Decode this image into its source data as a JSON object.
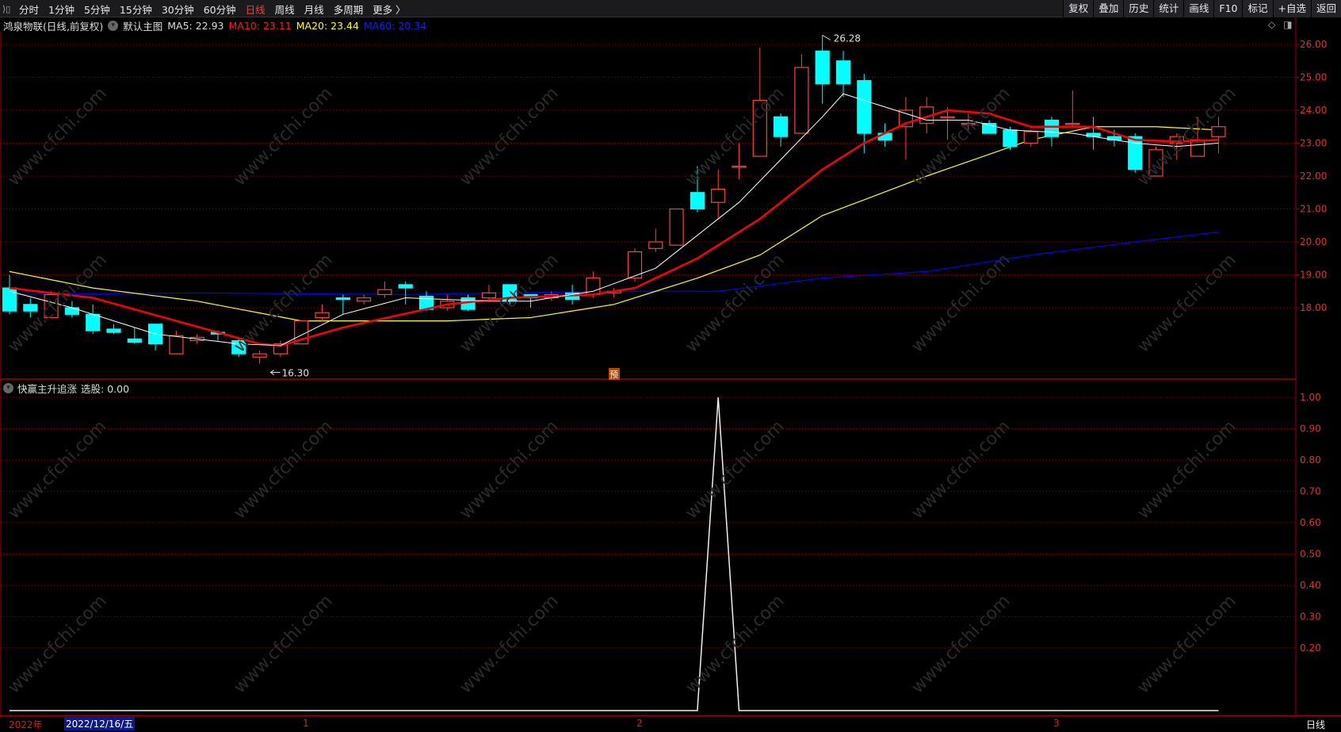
{
  "toolbar": {
    "periods": [
      "分时",
      "1分钟",
      "5分钟",
      "15分钟",
      "30分钟",
      "60分钟",
      "日线",
      "周线",
      "月线",
      "多周期",
      "更多 〉"
    ],
    "active_period": "日线",
    "right_buttons": [
      "复权",
      "叠加",
      "历史",
      "统计",
      "画线",
      "F10",
      "标记",
      "+自选",
      "返回"
    ]
  },
  "info": {
    "title": "鸿泉物联(日线,前复权)",
    "template": "默认主图",
    "ma5": "MA5: 22.93",
    "ma10": "MA10: 23.11",
    "ma20": "MA20: 23.44",
    "ma60": "MA60: 20.34"
  },
  "colors": {
    "up": "#ff4040",
    "down": "#00ffff",
    "ma5": "#ffffff",
    "ma10": "#ff0000",
    "ma20": "#ffff00",
    "ma60": "#0000ff",
    "grid": "#8b0000"
  },
  "annotations": {
    "high": "26.28",
    "low": "16.30",
    "badge": "预"
  },
  "sub": {
    "title": "快赢主升追涨",
    "value": "选股: 0.00"
  },
  "dates": {
    "year": "2022年",
    "cursor": "2022/12/16/五",
    "months": [
      "1",
      "2",
      "3"
    ],
    "period": "日线"
  },
  "watermark": "www.cfchi.com",
  "chart_data": {
    "type": "candlestick",
    "price_ticks": [
      "26.00",
      "25.00",
      "24.00",
      "23.00",
      "22.00",
      "21.00",
      "20.00",
      "19.00",
      "18.00"
    ],
    "ohlc": [
      [
        18.6,
        19.0,
        17.8,
        17.9
      ],
      [
        18.1,
        18.3,
        17.7,
        17.9
      ],
      [
        17.7,
        18.5,
        17.7,
        18.4
      ],
      [
        18.0,
        18.2,
        17.7,
        17.8
      ],
      [
        17.8,
        18.1,
        17.2,
        17.3
      ],
      [
        17.35,
        17.5,
        17.2,
        17.25
      ],
      [
        17.05,
        17.4,
        16.9,
        16.95
      ],
      [
        17.5,
        17.5,
        16.7,
        16.9
      ],
      [
        16.6,
        17.3,
        16.6,
        17.15
      ],
      [
        17.0,
        17.2,
        16.9,
        17.1
      ],
      [
        17.25,
        17.3,
        17.0,
        17.2
      ],
      [
        17.0,
        17.1,
        16.5,
        16.6
      ],
      [
        16.5,
        16.7,
        16.3,
        16.6
      ],
      [
        16.6,
        17.0,
        16.5,
        16.9
      ],
      [
        16.9,
        17.6,
        16.9,
        17.6
      ],
      [
        17.7,
        18.1,
        17.6,
        17.85
      ],
      [
        18.3,
        18.4,
        17.8,
        18.25
      ],
      [
        18.2,
        18.4,
        18.1,
        18.3
      ],
      [
        18.4,
        18.8,
        18.3,
        18.55
      ],
      [
        18.7,
        18.8,
        18.1,
        18.6
      ],
      [
        18.35,
        18.5,
        17.9,
        17.95
      ],
      [
        18.0,
        18.4,
        17.9,
        18.2
      ],
      [
        18.3,
        18.4,
        17.9,
        17.95
      ],
      [
        18.3,
        18.7,
        18.2,
        18.45
      ],
      [
        18.7,
        18.7,
        18.1,
        18.2
      ],
      [
        18.4,
        18.4,
        18.0,
        18.3
      ],
      [
        18.3,
        18.5,
        18.2,
        18.4
      ],
      [
        18.45,
        18.7,
        18.1,
        18.25
      ],
      [
        18.4,
        19.1,
        18.3,
        18.9
      ],
      [
        18.45,
        18.6,
        18.3,
        18.5
      ],
      [
        18.9,
        19.8,
        18.8,
        19.7
      ],
      [
        19.8,
        20.4,
        19.7,
        20.0
      ],
      [
        19.9,
        21.0,
        19.9,
        21.0
      ],
      [
        21.5,
        22.3,
        20.9,
        21.0
      ],
      [
        21.2,
        22.2,
        20.7,
        21.6
      ],
      [
        22.3,
        23.0,
        21.9,
        22.3
      ],
      [
        22.6,
        25.9,
        22.6,
        24.3
      ],
      [
        23.8,
        23.9,
        22.9,
        23.2
      ],
      [
        23.3,
        25.7,
        23.3,
        25.3
      ],
      [
        25.8,
        26.28,
        24.2,
        24.8
      ],
      [
        25.5,
        25.8,
        24.4,
        24.8
      ],
      [
        24.9,
        25.1,
        22.7,
        23.3
      ],
      [
        23.3,
        23.6,
        22.9,
        23.1
      ],
      [
        23.5,
        24.4,
        22.5,
        24.0
      ],
      [
        23.6,
        24.4,
        23.3,
        24.1
      ],
      [
        23.8,
        24.1,
        23.1,
        23.8
      ],
      [
        23.6,
        23.9,
        23.4,
        23.6
      ],
      [
        23.6,
        23.7,
        23.3,
        23.3
      ],
      [
        23.4,
        23.5,
        22.8,
        22.9
      ],
      [
        23.0,
        23.4,
        22.9,
        23.35
      ],
      [
        23.7,
        23.8,
        22.9,
        23.2
      ],
      [
        23.6,
        24.6,
        23.5,
        23.6
      ],
      [
        23.3,
        23.8,
        22.8,
        23.2
      ],
      [
        23.2,
        23.4,
        22.9,
        23.1
      ],
      [
        23.2,
        23.3,
        22.1,
        22.2
      ],
      [
        22.0,
        22.9,
        22.0,
        22.8
      ],
      [
        23.0,
        23.3,
        22.5,
        23.2
      ],
      [
        22.6,
        23.8,
        22.6,
        23.1
      ],
      [
        23.2,
        23.8,
        22.7,
        23.5
      ]
    ],
    "ma_knots": {
      "ma5": [
        [
          1,
          18.5
        ],
        [
          4,
          18.0
        ],
        [
          8,
          17.2
        ],
        [
          12,
          16.9
        ],
        [
          14,
          16.85
        ],
        [
          17,
          17.8
        ],
        [
          20,
          18.3
        ],
        [
          24,
          18.2
        ],
        [
          26,
          18.2
        ],
        [
          29,
          18.5
        ],
        [
          32,
          19.2
        ],
        [
          34,
          20.2
        ],
        [
          36,
          21.2
        ],
        [
          38,
          22.5
        ],
        [
          40,
          23.8
        ],
        [
          41,
          24.5
        ],
        [
          43,
          24.1
        ],
        [
          45,
          23.7
        ],
        [
          47,
          23.7
        ],
        [
          49,
          23.4
        ],
        [
          52,
          23.3
        ],
        [
          55,
          23.0
        ],
        [
          57,
          22.9
        ],
        [
          59,
          23.0
        ]
      ],
      "ma10": [
        [
          1,
          18.6
        ],
        [
          5,
          18.3
        ],
        [
          9,
          17.6
        ],
        [
          13,
          16.9
        ],
        [
          14,
          16.85
        ],
        [
          17,
          17.4
        ],
        [
          22,
          18.1
        ],
        [
          25,
          18.3
        ],
        [
          29,
          18.4
        ],
        [
          31,
          18.6
        ],
        [
          34,
          19.5
        ],
        [
          37,
          20.7
        ],
        [
          40,
          22.2
        ],
        [
          42,
          23.0
        ],
        [
          44,
          23.6
        ],
        [
          46,
          24.0
        ],
        [
          48,
          23.9
        ],
        [
          50,
          23.5
        ],
        [
          53,
          23.5
        ],
        [
          55,
          23.1
        ],
        [
          57,
          23.05
        ],
        [
          59,
          23.1
        ]
      ],
      "ma20": [
        [
          1,
          19.1
        ],
        [
          5,
          18.6
        ],
        [
          10,
          18.2
        ],
        [
          15,
          17.6
        ],
        [
          22,
          17.6
        ],
        [
          26,
          17.7
        ],
        [
          30,
          18.1
        ],
        [
          34,
          18.9
        ],
        [
          37,
          19.6
        ],
        [
          40,
          20.8
        ],
        [
          45,
          22.0
        ],
        [
          50,
          23.1
        ],
        [
          53,
          23.5
        ],
        [
          56,
          23.5
        ],
        [
          59,
          23.4
        ]
      ],
      "ma60": [
        [
          1,
          18.4
        ],
        [
          10,
          18.45
        ],
        [
          20,
          18.4
        ],
        [
          30,
          18.5
        ],
        [
          35,
          18.5
        ],
        [
          40,
          18.9
        ],
        [
          45,
          19.1
        ],
        [
          50,
          19.6
        ],
        [
          55,
          20.0
        ],
        [
          59,
          20.3
        ]
      ]
    },
    "sub_ticks": [
      "1.00",
      "0.90",
      "0.80",
      "0.70",
      "0.60",
      "0.50",
      "0.40",
      "0.30",
      "0.20"
    ],
    "signal_spike_index": 35
  }
}
